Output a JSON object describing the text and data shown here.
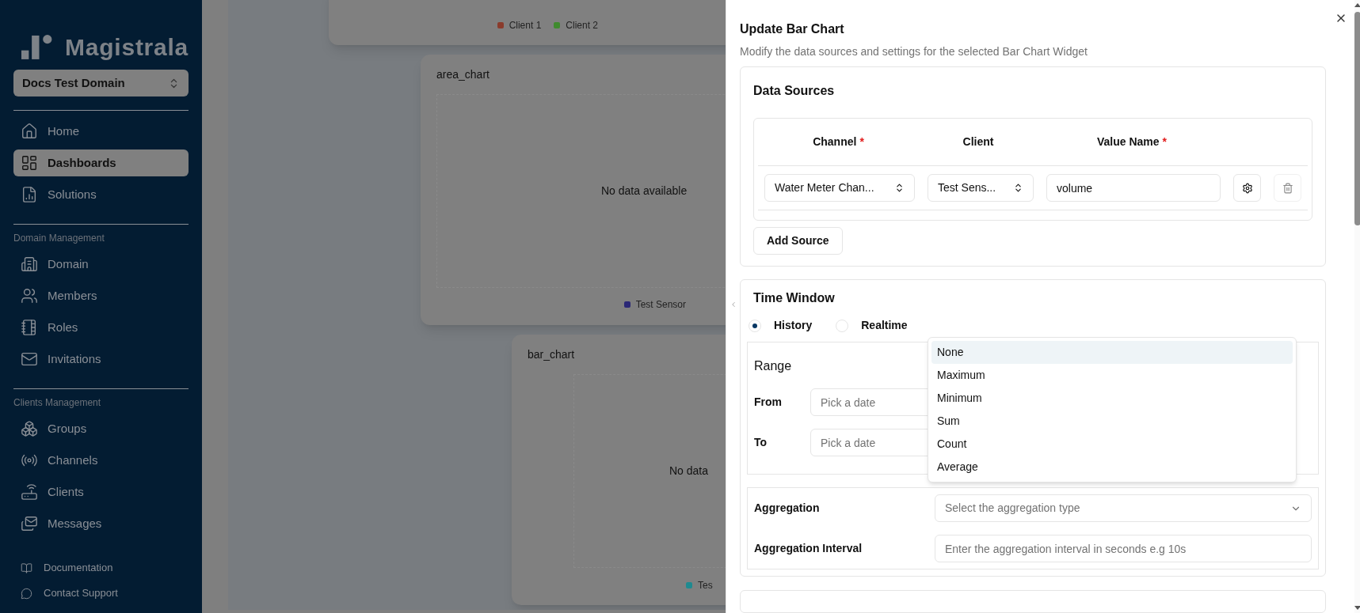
{
  "sidebar": {
    "brand": "Magistrala",
    "domain_select": "Docs Test Domain",
    "sections": [
      {
        "items": [
          {
            "label": "Home",
            "selected": false
          },
          {
            "label": "Dashboards",
            "selected": true
          },
          {
            "label": "Solutions",
            "selected": false
          }
        ]
      },
      {
        "heading": "Domain Management",
        "items": [
          {
            "label": "Domain",
            "selected": false
          },
          {
            "label": "Members",
            "selected": false
          },
          {
            "label": "Roles",
            "selected": false
          },
          {
            "label": "Invitations",
            "selected": false
          }
        ]
      },
      {
        "heading": "Clients Management",
        "items": [
          {
            "label": "Groups",
            "selected": false
          },
          {
            "label": "Channels",
            "selected": false
          },
          {
            "label": "Clients",
            "selected": false
          },
          {
            "label": "Messages",
            "selected": false
          }
        ]
      }
    ],
    "footer_links": [
      "Documentation",
      "Contact Support"
    ]
  },
  "widgets": [
    {
      "legend": [
        {
          "label": "Client 1",
          "color": "#8a3b2c"
        },
        {
          "label": "Client 2",
          "color": "#3f8a2e"
        }
      ]
    },
    {
      "title": "area_chart",
      "message": "No data available",
      "legend": [
        {
          "label": "Test Sensor",
          "color": "#2b2876"
        }
      ]
    },
    {
      "title": "bar_chart",
      "message": "No data",
      "legend": [
        {
          "label": "Tes",
          "color": "#1f8a90"
        }
      ]
    }
  ],
  "dialog": {
    "title": "Update Bar Chart",
    "description": "Modify the data sources and settings for the selected Bar Chart Widget",
    "data_sources": {
      "title": "Data Sources",
      "required_marker": "*",
      "columns": [
        {
          "label": "Channel",
          "required": true
        },
        {
          "label": "Client",
          "required": false
        },
        {
          "label": "Value Name",
          "required": true
        }
      ],
      "rows": [
        {
          "channel": "Water Meter Chan...",
          "client": "Test Sens...",
          "value_name": "volume"
        }
      ],
      "add_button": "Add Source"
    },
    "time_window": {
      "title": "Time Window",
      "modes": [
        {
          "label": "History",
          "selected": true
        },
        {
          "label": "Realtime",
          "selected": false
        }
      ],
      "range": {
        "title": "Range",
        "fields": [
          {
            "label": "From",
            "placeholder": "Pick a date"
          },
          {
            "label": "To",
            "placeholder": "Pick a date"
          }
        ]
      },
      "aggregation": {
        "label": "Aggregation",
        "placeholder": "Select the aggregation type"
      },
      "interval": {
        "label": "Aggregation Interval",
        "placeholder": "Enter the aggregation interval in seconds e.g 10s"
      },
      "dropdown": [
        {
          "label": "None",
          "selected": true
        },
        {
          "label": "Maximum",
          "selected": false
        },
        {
          "label": "Minimum",
          "selected": false
        },
        {
          "label": "Sum",
          "selected": false
        },
        {
          "label": "Count",
          "selected": false
        },
        {
          "label": "Average",
          "selected": false
        }
      ]
    }
  }
}
